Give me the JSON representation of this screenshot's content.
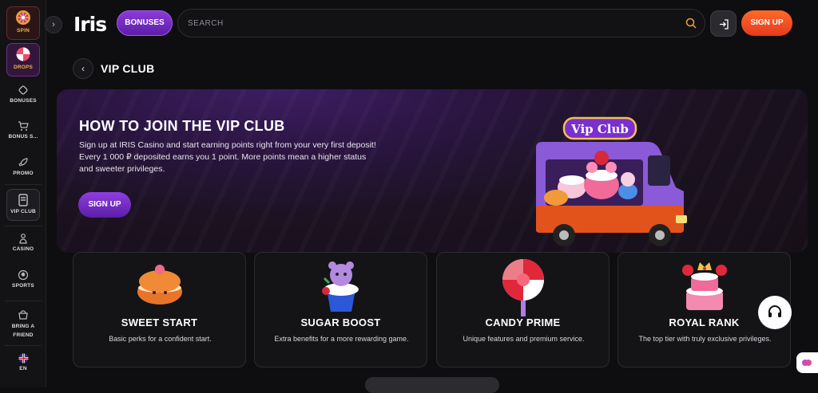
{
  "sidebar": {
    "items": [
      {
        "label": "SPIN",
        "icon": "spin-wheel-icon"
      },
      {
        "label": "DROPS",
        "icon": "drops-icon"
      },
      {
        "label": "BONUSES",
        "icon": "bonus-candy-icon"
      },
      {
        "label": "BONUS S...",
        "icon": "cart-icon"
      },
      {
        "label": "PROMO",
        "icon": "rocket-icon"
      },
      {
        "label": "VIP CLUB",
        "icon": "vip-card-icon"
      },
      {
        "label": "CASINO",
        "icon": "casino-icon"
      },
      {
        "label": "SPORTS",
        "icon": "sports-ball-icon"
      },
      {
        "label": "BRING A FRIEND",
        "icon": "gift-basket-icon"
      },
      {
        "label": "EN",
        "icon": "uk-flag-icon"
      }
    ]
  },
  "header": {
    "logo": "Iris",
    "bonuses_label": "BONUSES",
    "search_placeholder": "SEARCH",
    "signup_label": "SIGN UP"
  },
  "page": {
    "title": "VIP CLUB"
  },
  "hero": {
    "title": "HOW TO JOIN THE VIP CLUB",
    "description": "Sign up at IRIS Casino and start earning points right from your very first deposit! Every 1 000 ₽ deposited earns you 1 point. More points mean a higher status and sweeter privileges.",
    "signup_label": "SIGN UP",
    "truck_sign": "Vip Club"
  },
  "levels": [
    {
      "name": "SWEET START",
      "description": "Basic perks for a confident start."
    },
    {
      "name": "SUGAR BOOST",
      "description": "Extra benefits for a more rewarding game."
    },
    {
      "name": "CANDY PRIME",
      "description": "Unique features and premium service."
    },
    {
      "name": "ROYAL RANK",
      "description": "The top tier with truly exclusive privileges."
    }
  ],
  "colors": {
    "accent_purple": "#7a2fd0",
    "accent_orange": "#f0502a",
    "background": "#0e0e10"
  }
}
